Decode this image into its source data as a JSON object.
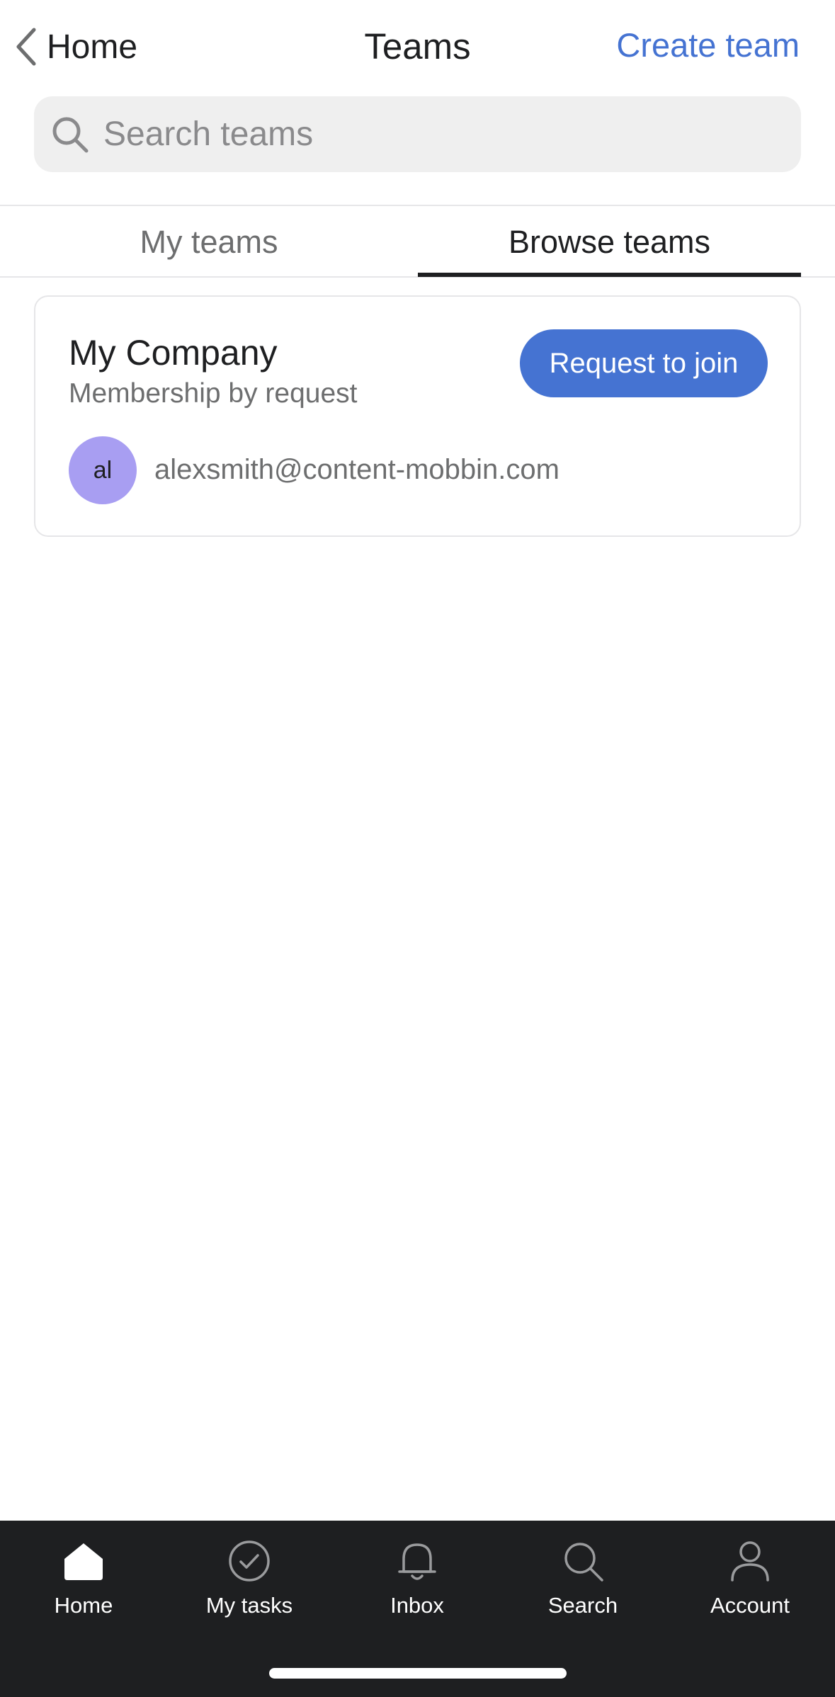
{
  "header": {
    "back_label": "Home",
    "title": "Teams",
    "create_label": "Create team"
  },
  "search": {
    "placeholder": "Search teams",
    "value": ""
  },
  "tabs": [
    {
      "label": "My teams",
      "active": false
    },
    {
      "label": "Browse teams",
      "active": true
    }
  ],
  "team_card": {
    "name": "My Company",
    "membership": "Membership by request",
    "join_label": "Request to join",
    "member": {
      "initials": "al",
      "email": "alexsmith@content-mobbin.com"
    }
  },
  "bottom_nav": [
    {
      "label": "Home",
      "icon": "home-icon"
    },
    {
      "label": "My tasks",
      "icon": "check-circle-icon"
    },
    {
      "label": "Inbox",
      "icon": "bell-icon"
    },
    {
      "label": "Search",
      "icon": "search-icon"
    },
    {
      "label": "Account",
      "icon": "person-icon"
    }
  ],
  "colors": {
    "accent": "#4573d2",
    "avatar": "#a89ef2",
    "nav_background": "#1e1f21",
    "search_background": "#efefef"
  }
}
